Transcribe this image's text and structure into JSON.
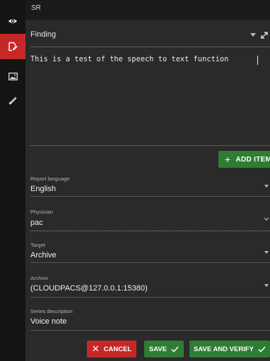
{
  "rail": {
    "items": [
      {
        "icon": "eye-icon",
        "active": false
      },
      {
        "icon": "report-edit-icon",
        "active": true
      },
      {
        "icon": "image-icon",
        "active": false
      },
      {
        "icon": "ruler-icon",
        "active": false
      }
    ]
  },
  "header": {
    "title": "SR"
  },
  "finding": {
    "label": "Finding"
  },
  "editor": {
    "text": "This is a test of the speech to text function"
  },
  "add_item": {
    "label": "ADD ITEM"
  },
  "fields": {
    "report_language": {
      "label": "Report language",
      "value": "English"
    },
    "physician": {
      "label": "Physician",
      "value": "pac"
    },
    "target": {
      "label": "Target",
      "value": "Archive"
    },
    "archive": {
      "label": "Archive",
      "value": "(CLOUDPACS@127.0.0.1:15380)"
    },
    "series_description": {
      "label": "Series description",
      "value": "Voice note"
    }
  },
  "actions": {
    "cancel": "CANCEL",
    "save": "SAVE",
    "save_verify": "SAVE AND VERIFY"
  },
  "colors": {
    "accent_red": "#c62828",
    "accent_green": "#2e7d32",
    "panel_bg": "#2a2a2a",
    "rail_bg": "#141414"
  }
}
